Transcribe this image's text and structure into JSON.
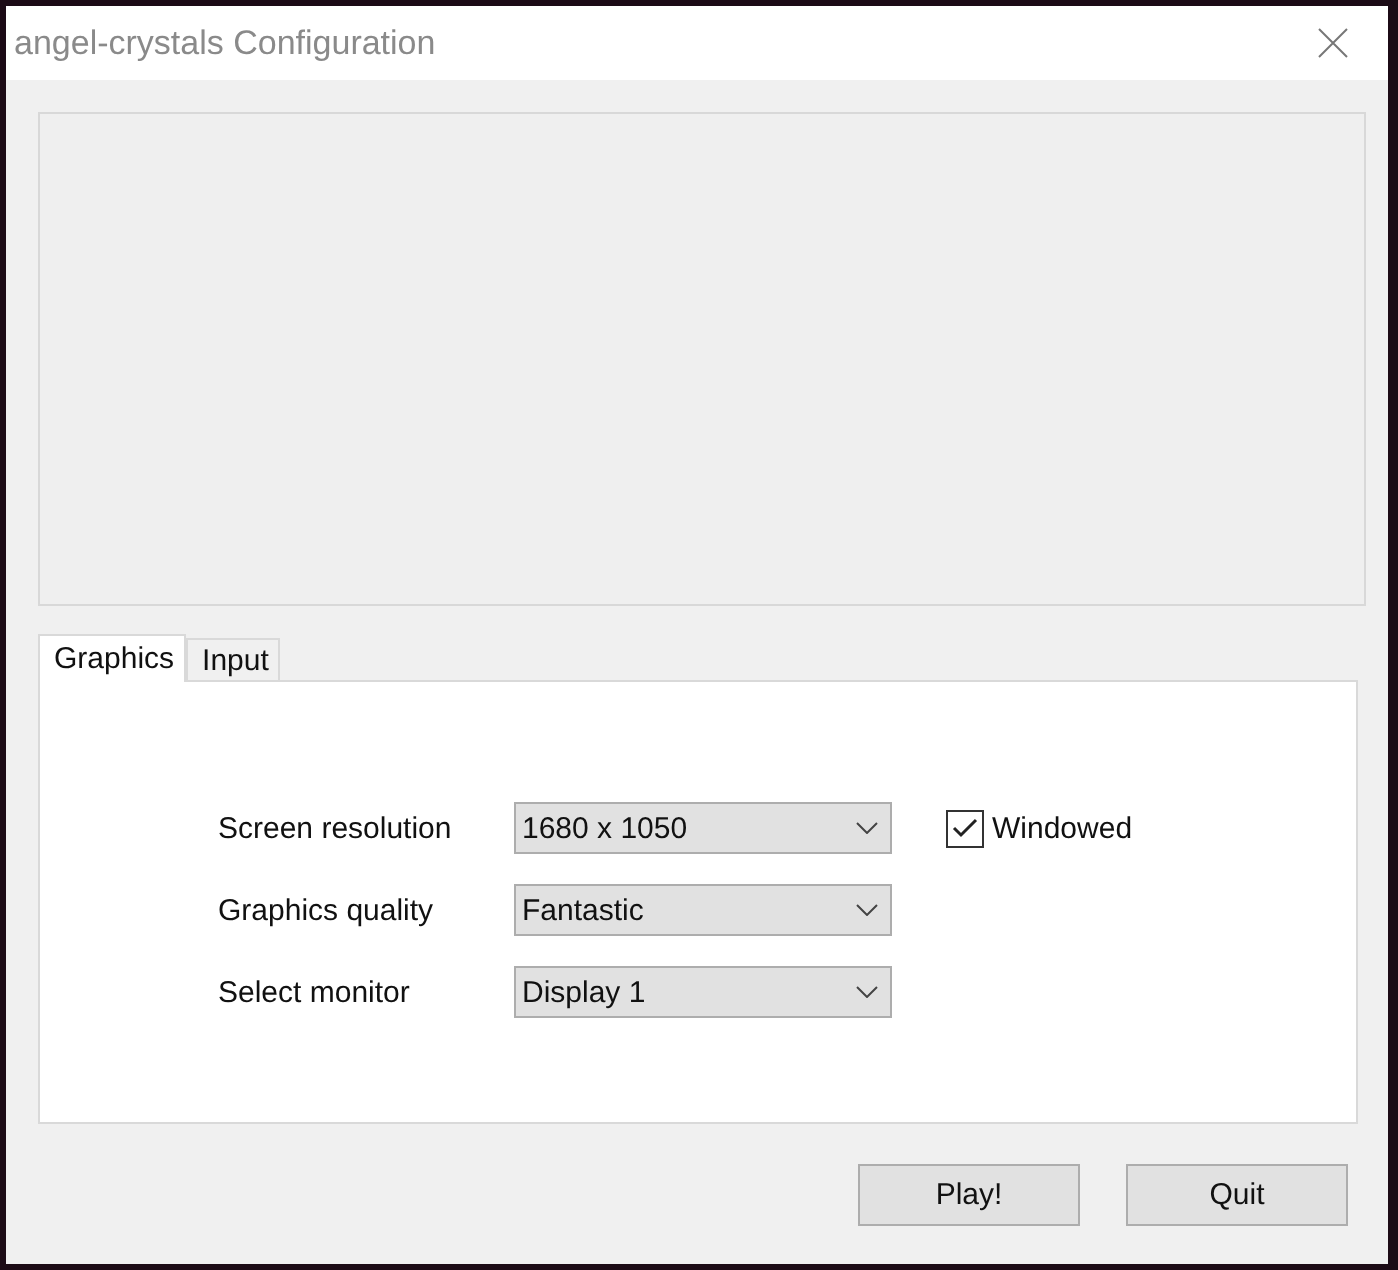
{
  "window": {
    "title": "angel-crystals Configuration"
  },
  "tabs": [
    {
      "label": "Graphics",
      "selected": true
    },
    {
      "label": "Input",
      "selected": false
    }
  ],
  "settings": [
    {
      "label": "Screen resolution",
      "value": "1680 x 1050"
    },
    {
      "label": "Graphics quality",
      "value": "Fantastic"
    },
    {
      "label": "Select monitor",
      "value": "Display 1"
    }
  ],
  "windowed": {
    "label": "Windowed",
    "checked": true
  },
  "buttons": [
    "Play!",
    "Quit"
  ]
}
